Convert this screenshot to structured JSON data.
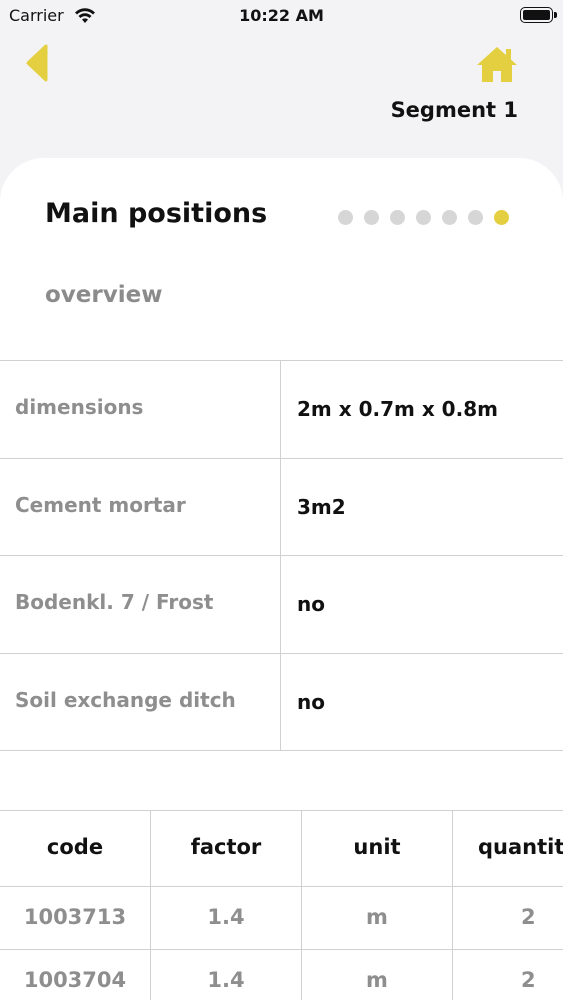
{
  "status_bar": {
    "carrier": "Carrier",
    "time": "10:22 AM"
  },
  "nav": {
    "back_icon": "chevron-left-icon",
    "home_icon": "home-icon",
    "segment_title": "Segment 1",
    "accent_color": "#e3cf3f"
  },
  "card": {
    "title": "Main positions",
    "subtitle": "overview",
    "pager": {
      "total": 7,
      "active": 7
    }
  },
  "info_rows": [
    {
      "label": "dimensions",
      "value": "2m x 0.7m x 0.8m"
    },
    {
      "label": "Cement mortar",
      "value": "3m2"
    },
    {
      "label": "Bodenkl. 7 / Frost",
      "value": "no"
    },
    {
      "label": "Soil exchange ditch",
      "value": "no"
    }
  ],
  "positions": {
    "columns": [
      "code",
      "factor",
      "unit",
      "quantit"
    ],
    "rows": [
      [
        "1003713",
        "1.4",
        "m",
        "2"
      ],
      [
        "1003704",
        "1.4",
        "m",
        "2"
      ]
    ]
  }
}
